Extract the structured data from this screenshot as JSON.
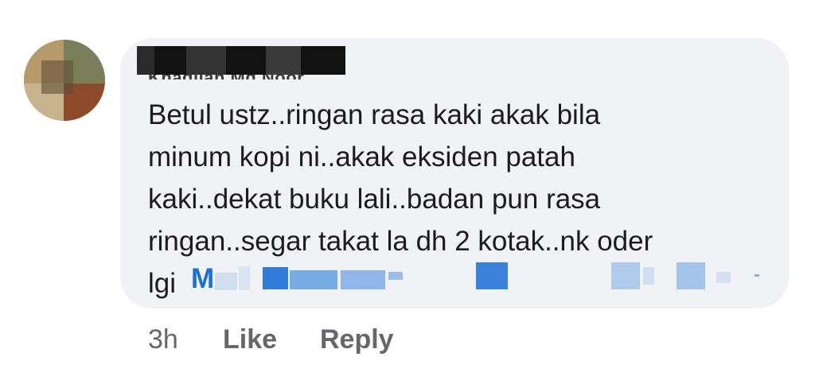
{
  "comment": {
    "author_visible_fragment": "Khadijah Md Noor",
    "text_lines": [
      "Betul ustz..ringan rasa kaki akak bila",
      "minum kopi ni..akak eksiden patah",
      "kaki..dekat buku lali..badan pun rasa",
      "ringan..segar takat la dh 2 kotak..nk oder",
      "lgi"
    ],
    "mention_visible_fragment": "M",
    "timestamp": "3h",
    "like_label": "Like",
    "reply_label": "Reply"
  },
  "colors": {
    "bubble": "#f0f2f5",
    "text": "#1c1c1c",
    "link": "#1a6fd6",
    "meta": "#65676b"
  }
}
